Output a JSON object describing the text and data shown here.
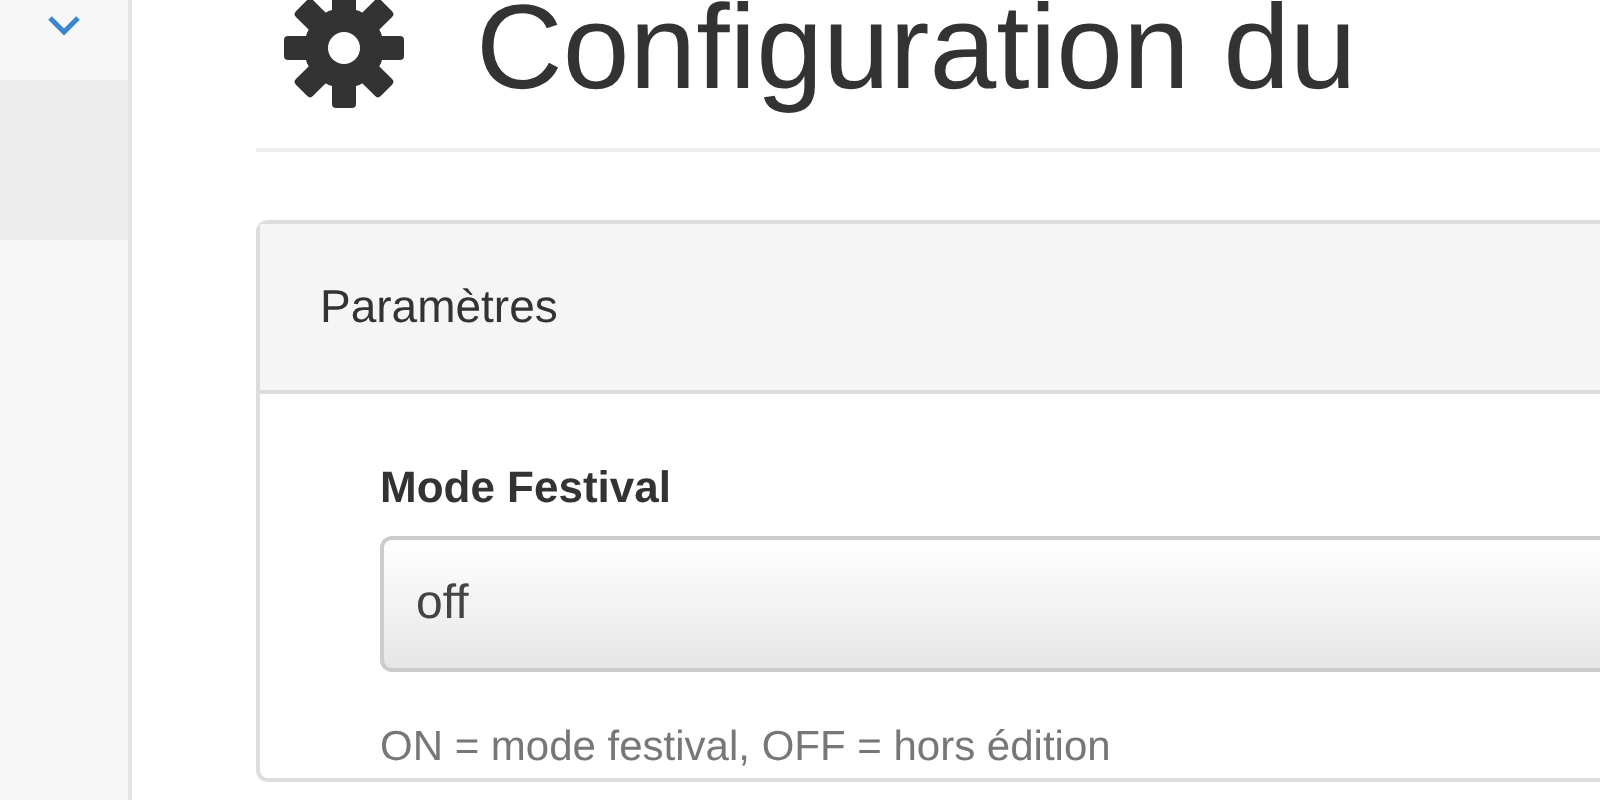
{
  "page": {
    "title": "Configuration du"
  },
  "panel": {
    "title": "Paramètres",
    "fields": [
      {
        "label": "Mode Festival",
        "value": "off",
        "help": "ON = mode festival, OFF = hors édition"
      }
    ]
  }
}
